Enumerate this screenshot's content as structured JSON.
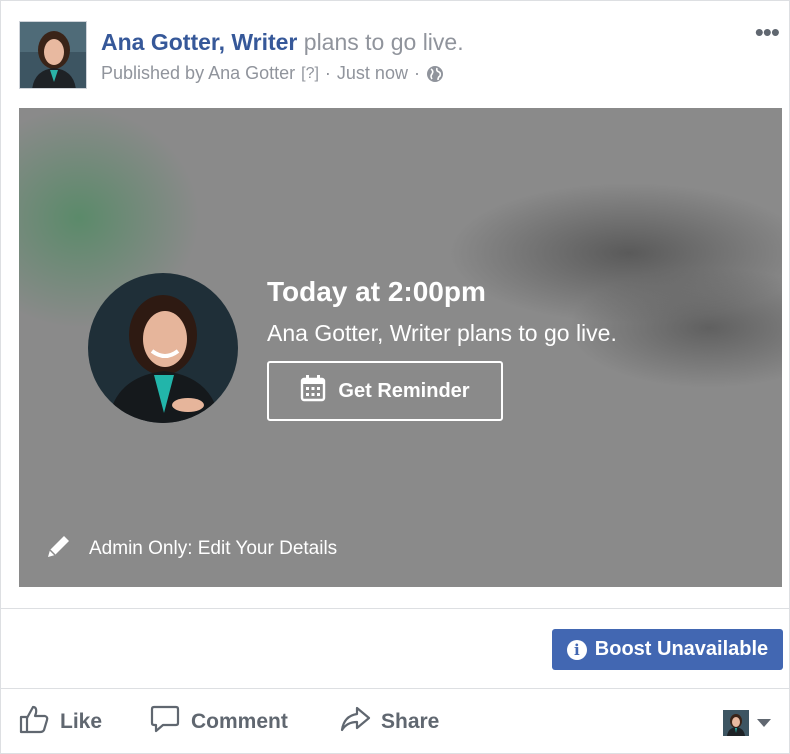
{
  "post": {
    "author": "Ana Gotter, Writer",
    "action": "plans to go live.",
    "published_prefix": "Published by Ana Gotter",
    "help": "[?]",
    "separator": "·",
    "time": "Just now",
    "separator2": "·",
    "privacy_icon": "globe-icon",
    "more_icon": "more-options-icon"
  },
  "preview": {
    "when": "Today at 2:00pm",
    "subtitle": "Ana Gotter, Writer plans to go live.",
    "reminder_label": "Get Reminder",
    "reminder_icon": "calendar-icon",
    "admin_label": "Admin Only: Edit Your Details",
    "admin_icon": "pencil-icon"
  },
  "boost": {
    "label": "Boost Unavailable",
    "icon": "info-icon"
  },
  "actions": {
    "like": "Like",
    "comment": "Comment",
    "share": "Share"
  },
  "colors": {
    "link": "#365899",
    "boost": "#4267b2",
    "muted": "#90949c",
    "action": "#606770"
  }
}
